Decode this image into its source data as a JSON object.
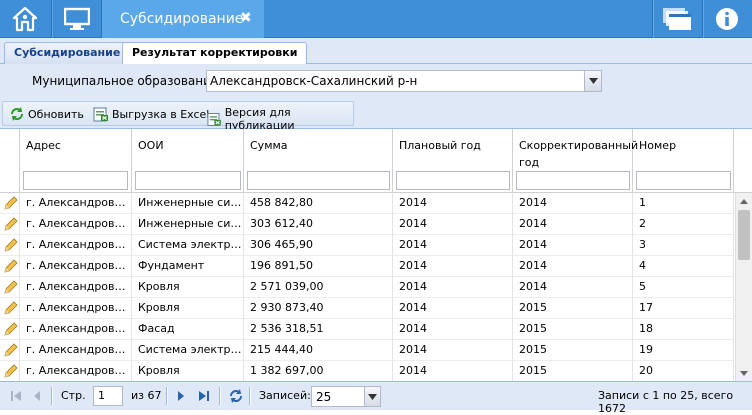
{
  "topbar": {
    "tab_title": "Субсидирование",
    "icons": [
      "home-icon",
      "monitor-icon",
      "close-icon",
      "windows-icon",
      "info-icon"
    ],
    "color": "#3f8fd8",
    "active_color": "#5aa8ea"
  },
  "subtabs": [
    {
      "label": "Субсидирование"
    },
    {
      "label": "Результат корректировки"
    }
  ],
  "filter": {
    "label": "Муниципальное образование:",
    "value": "Александровск-Сахалинский р-н"
  },
  "toolbar": {
    "refresh": "Обновить",
    "export": "Выгрузка в Excel",
    "publish": "Версия для публикации"
  },
  "grid": {
    "columns": [
      "Адрес",
      "ООИ",
      "Сумма",
      "Плановый год",
      "Скорректированный год",
      "Номер"
    ],
    "rows": [
      {
        "address": "г. Александровс…",
        "ooi": "Инженерные сис…",
        "sum": "458 842,80",
        "plan": "2014",
        "adj": "2014",
        "num": "1"
      },
      {
        "address": "г. Александровс…",
        "ooi": "Инженерные сис…",
        "sum": "303 612,40",
        "plan": "2014",
        "adj": "2014",
        "num": "2"
      },
      {
        "address": "г. Александровс…",
        "ooi": "Система электро…",
        "sum": "306 465,90",
        "plan": "2014",
        "adj": "2014",
        "num": "3"
      },
      {
        "address": "г. Александровс…",
        "ooi": "Фундамент",
        "sum": "196 891,50",
        "plan": "2014",
        "adj": "2014",
        "num": "4"
      },
      {
        "address": "г. Александровс…",
        "ooi": "Кровля",
        "sum": "2 571 039,00",
        "plan": "2014",
        "adj": "2014",
        "num": "5"
      },
      {
        "address": "г. Александровс…",
        "ooi": "Кровля",
        "sum": "2 930 873,40",
        "plan": "2014",
        "adj": "2015",
        "num": "17"
      },
      {
        "address": "г. Александровс…",
        "ooi": "Фасад",
        "sum": "2 536 318,51",
        "plan": "2014",
        "adj": "2015",
        "num": "18"
      },
      {
        "address": "г. Александровс…",
        "ooi": "Система электро…",
        "sum": "215 444,40",
        "plan": "2014",
        "adj": "2015",
        "num": "19"
      },
      {
        "address": "г. Александровс…",
        "ooi": "Кровля",
        "sum": "1 382 697,00",
        "plan": "2014",
        "adj": "2015",
        "num": "20"
      }
    ]
  },
  "paging": {
    "page_label": "Стр.",
    "page": "1",
    "of_label": "из 67",
    "records_label": "Записей:",
    "records_value": "25",
    "summary": "Записи с 1 по 25, всего 1672"
  }
}
